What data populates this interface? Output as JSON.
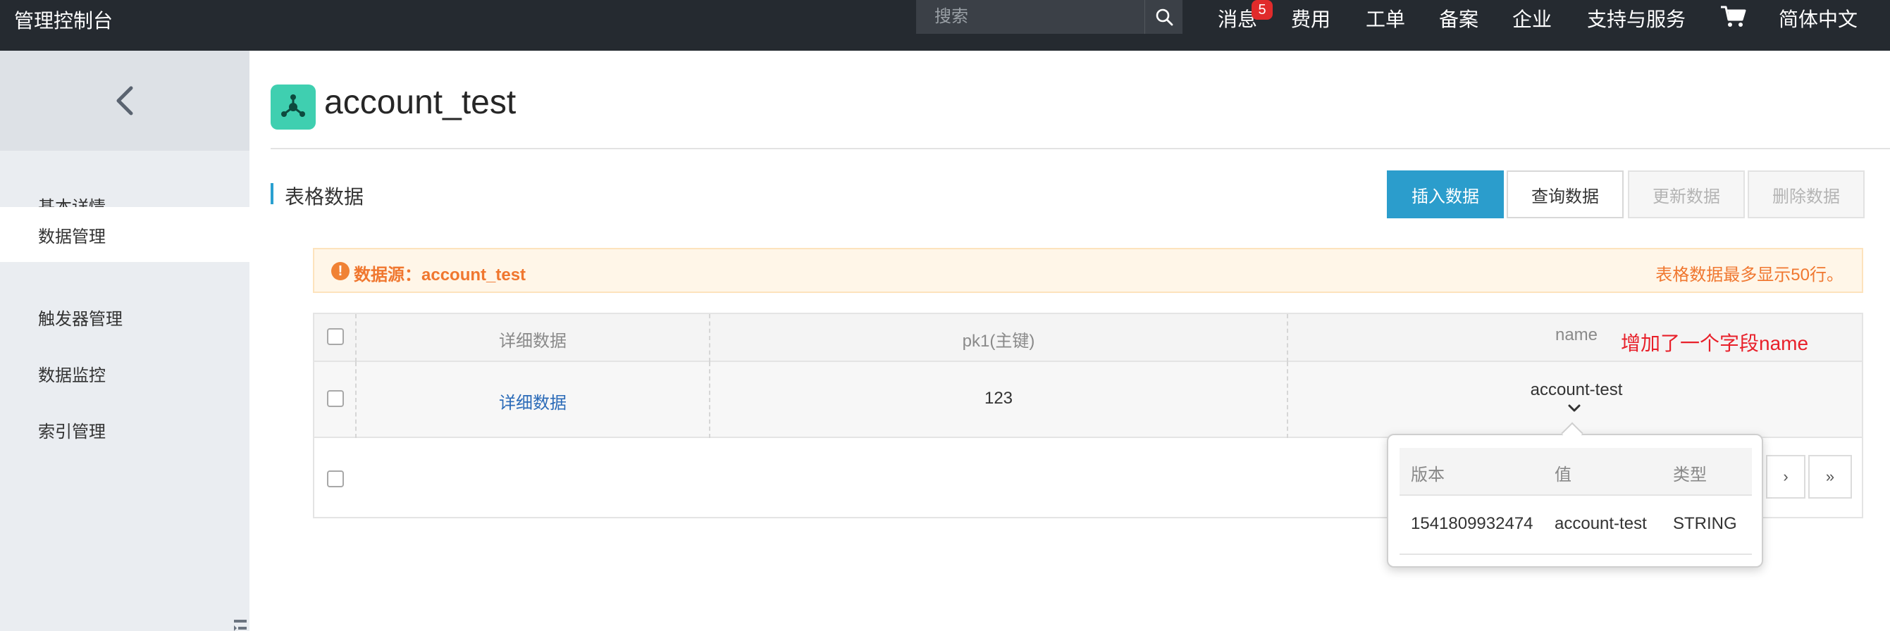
{
  "topbar": {
    "console_title": "管理控制台",
    "search_placeholder": "搜索",
    "nav": {
      "messages": "消息",
      "messages_badge": "5",
      "billing": "费用",
      "tickets": "工单",
      "icp": "备案",
      "enterprise": "企业",
      "support": "支持与服务",
      "language": "简体中文"
    }
  },
  "sidebar": {
    "items": [
      {
        "label": "基本详情"
      },
      {
        "label": "数据管理"
      },
      {
        "label": "触发器管理"
      },
      {
        "label": "数据监控"
      },
      {
        "label": "索引管理"
      }
    ],
    "active_index": 1
  },
  "header": {
    "title": "account_test"
  },
  "section": {
    "title": "表格数据",
    "buttons": {
      "insert": "插入数据",
      "query": "查询数据",
      "update": "更新数据",
      "delete": "删除数据"
    }
  },
  "notice": {
    "source": "数据源：account_test",
    "limit": "表格数据最多显示50行。"
  },
  "table": {
    "columns": [
      "详细数据",
      "pk1(主键)",
      "name"
    ],
    "rows": [
      {
        "detail": "详细数据",
        "pk1": "123",
        "name": "account-test"
      }
    ],
    "annotation": "增加了一个字段name"
  },
  "pagination": {
    "next": "›",
    "last": "»"
  },
  "popover": {
    "columns": [
      "版本",
      "值",
      "类型"
    ],
    "rows": [
      {
        "version": "1541809932474",
        "value": "account-test",
        "type": "STRING"
      }
    ]
  },
  "colors": {
    "topbar": "#252a30",
    "primary": "#2b9dcc",
    "warning": "#f0772f",
    "annotation": "#e8202a",
    "app_icon": "#3fcfb0"
  }
}
